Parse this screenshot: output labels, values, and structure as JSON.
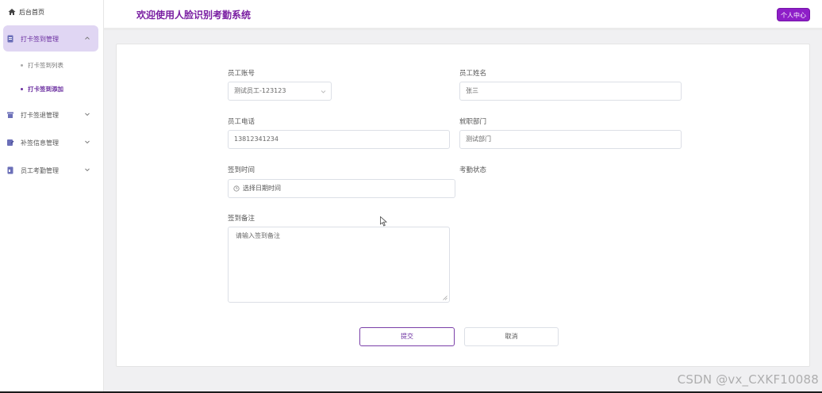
{
  "sidebar": {
    "home_label": "后台首页",
    "menus": [
      {
        "label": "打卡签到管理",
        "expanded": true
      },
      {
        "label": "打卡签退管理"
      },
      {
        "label": "补签信息管理"
      },
      {
        "label": "员工考勤管理"
      }
    ],
    "submenu": [
      {
        "label": "打卡签到列表"
      },
      {
        "label": "打卡签到添加"
      }
    ]
  },
  "header": {
    "title": "欢迎使用人脸识别考勤系统",
    "profile_button": "个人中心"
  },
  "form": {
    "employee_account": {
      "label": "员工账号",
      "value": "测试员工-123123"
    },
    "employee_name": {
      "label": "员工姓名",
      "value": "张三"
    },
    "employee_phone": {
      "label": "员工电话",
      "value": "13812341234"
    },
    "department": {
      "label": "就职部门",
      "value": "测试部门"
    },
    "checkin_time": {
      "label": "签到时间",
      "placeholder": "选择日期时间"
    },
    "attendance_status": {
      "label": "考勤状态"
    },
    "checkin_note": {
      "label": "签到备注",
      "placeholder": "请输入签到备注"
    },
    "submit_label": "提交",
    "cancel_label": "取消"
  },
  "watermark": "CSDN @vx_CXKF10088",
  "colors": {
    "accent": "#7a1fa2",
    "active_bg": "#e0d6f3",
    "profile_btn": "#8e1ec8"
  }
}
